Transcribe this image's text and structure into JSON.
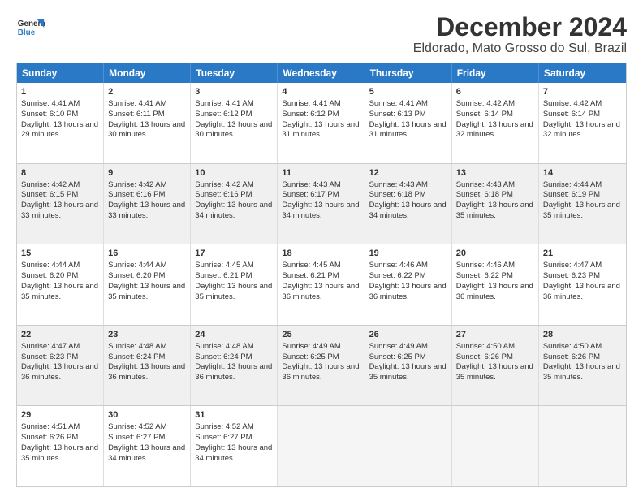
{
  "header": {
    "logo_line1": "General",
    "logo_line2": "Blue",
    "title": "December 2024",
    "subtitle": "Eldorado, Mato Grosso do Sul, Brazil"
  },
  "calendar": {
    "days": [
      "Sunday",
      "Monday",
      "Tuesday",
      "Wednesday",
      "Thursday",
      "Friday",
      "Saturday"
    ],
    "weeks": [
      [
        {
          "day": "1",
          "sunrise": "Sunrise: 4:41 AM",
          "sunset": "Sunset: 6:10 PM",
          "daylight": "Daylight: 13 hours and 29 minutes.",
          "shaded": false
        },
        {
          "day": "2",
          "sunrise": "Sunrise: 4:41 AM",
          "sunset": "Sunset: 6:11 PM",
          "daylight": "Daylight: 13 hours and 30 minutes.",
          "shaded": false
        },
        {
          "day": "3",
          "sunrise": "Sunrise: 4:41 AM",
          "sunset": "Sunset: 6:12 PM",
          "daylight": "Daylight: 13 hours and 30 minutes.",
          "shaded": false
        },
        {
          "day": "4",
          "sunrise": "Sunrise: 4:41 AM",
          "sunset": "Sunset: 6:12 PM",
          "daylight": "Daylight: 13 hours and 31 minutes.",
          "shaded": false
        },
        {
          "day": "5",
          "sunrise": "Sunrise: 4:41 AM",
          "sunset": "Sunset: 6:13 PM",
          "daylight": "Daylight: 13 hours and 31 minutes.",
          "shaded": false
        },
        {
          "day": "6",
          "sunrise": "Sunrise: 4:42 AM",
          "sunset": "Sunset: 6:14 PM",
          "daylight": "Daylight: 13 hours and 32 minutes.",
          "shaded": false
        },
        {
          "day": "7",
          "sunrise": "Sunrise: 4:42 AM",
          "sunset": "Sunset: 6:14 PM",
          "daylight": "Daylight: 13 hours and 32 minutes.",
          "shaded": false
        }
      ],
      [
        {
          "day": "8",
          "sunrise": "Sunrise: 4:42 AM",
          "sunset": "Sunset: 6:15 PM",
          "daylight": "Daylight: 13 hours and 33 minutes.",
          "shaded": true
        },
        {
          "day": "9",
          "sunrise": "Sunrise: 4:42 AM",
          "sunset": "Sunset: 6:16 PM",
          "daylight": "Daylight: 13 hours and 33 minutes.",
          "shaded": true
        },
        {
          "day": "10",
          "sunrise": "Sunrise: 4:42 AM",
          "sunset": "Sunset: 6:16 PM",
          "daylight": "Daylight: 13 hours and 34 minutes.",
          "shaded": true
        },
        {
          "day": "11",
          "sunrise": "Sunrise: 4:43 AM",
          "sunset": "Sunset: 6:17 PM",
          "daylight": "Daylight: 13 hours and 34 minutes.",
          "shaded": true
        },
        {
          "day": "12",
          "sunrise": "Sunrise: 4:43 AM",
          "sunset": "Sunset: 6:18 PM",
          "daylight": "Daylight: 13 hours and 34 minutes.",
          "shaded": true
        },
        {
          "day": "13",
          "sunrise": "Sunrise: 4:43 AM",
          "sunset": "Sunset: 6:18 PM",
          "daylight": "Daylight: 13 hours and 35 minutes.",
          "shaded": true
        },
        {
          "day": "14",
          "sunrise": "Sunrise: 4:44 AM",
          "sunset": "Sunset: 6:19 PM",
          "daylight": "Daylight: 13 hours and 35 minutes.",
          "shaded": true
        }
      ],
      [
        {
          "day": "15",
          "sunrise": "Sunrise: 4:44 AM",
          "sunset": "Sunset: 6:20 PM",
          "daylight": "Daylight: 13 hours and 35 minutes.",
          "shaded": false
        },
        {
          "day": "16",
          "sunrise": "Sunrise: 4:44 AM",
          "sunset": "Sunset: 6:20 PM",
          "daylight": "Daylight: 13 hours and 35 minutes.",
          "shaded": false
        },
        {
          "day": "17",
          "sunrise": "Sunrise: 4:45 AM",
          "sunset": "Sunset: 6:21 PM",
          "daylight": "Daylight: 13 hours and 35 minutes.",
          "shaded": false
        },
        {
          "day": "18",
          "sunrise": "Sunrise: 4:45 AM",
          "sunset": "Sunset: 6:21 PM",
          "daylight": "Daylight: 13 hours and 36 minutes.",
          "shaded": false
        },
        {
          "day": "19",
          "sunrise": "Sunrise: 4:46 AM",
          "sunset": "Sunset: 6:22 PM",
          "daylight": "Daylight: 13 hours and 36 minutes.",
          "shaded": false
        },
        {
          "day": "20",
          "sunrise": "Sunrise: 4:46 AM",
          "sunset": "Sunset: 6:22 PM",
          "daylight": "Daylight: 13 hours and 36 minutes.",
          "shaded": false
        },
        {
          "day": "21",
          "sunrise": "Sunrise: 4:47 AM",
          "sunset": "Sunset: 6:23 PM",
          "daylight": "Daylight: 13 hours and 36 minutes.",
          "shaded": false
        }
      ],
      [
        {
          "day": "22",
          "sunrise": "Sunrise: 4:47 AM",
          "sunset": "Sunset: 6:23 PM",
          "daylight": "Daylight: 13 hours and 36 minutes.",
          "shaded": true
        },
        {
          "day": "23",
          "sunrise": "Sunrise: 4:48 AM",
          "sunset": "Sunset: 6:24 PM",
          "daylight": "Daylight: 13 hours and 36 minutes.",
          "shaded": true
        },
        {
          "day": "24",
          "sunrise": "Sunrise: 4:48 AM",
          "sunset": "Sunset: 6:24 PM",
          "daylight": "Daylight: 13 hours and 36 minutes.",
          "shaded": true
        },
        {
          "day": "25",
          "sunrise": "Sunrise: 4:49 AM",
          "sunset": "Sunset: 6:25 PM",
          "daylight": "Daylight: 13 hours and 36 minutes.",
          "shaded": true
        },
        {
          "day": "26",
          "sunrise": "Sunrise: 4:49 AM",
          "sunset": "Sunset: 6:25 PM",
          "daylight": "Daylight: 13 hours and 35 minutes.",
          "shaded": true
        },
        {
          "day": "27",
          "sunrise": "Sunrise: 4:50 AM",
          "sunset": "Sunset: 6:26 PM",
          "daylight": "Daylight: 13 hours and 35 minutes.",
          "shaded": true
        },
        {
          "day": "28",
          "sunrise": "Sunrise: 4:50 AM",
          "sunset": "Sunset: 6:26 PM",
          "daylight": "Daylight: 13 hours and 35 minutes.",
          "shaded": true
        }
      ],
      [
        {
          "day": "29",
          "sunrise": "Sunrise: 4:51 AM",
          "sunset": "Sunset: 6:26 PM",
          "daylight": "Daylight: 13 hours and 35 minutes.",
          "shaded": false
        },
        {
          "day": "30",
          "sunrise": "Sunrise: 4:52 AM",
          "sunset": "Sunset: 6:27 PM",
          "daylight": "Daylight: 13 hours and 34 minutes.",
          "shaded": false
        },
        {
          "day": "31",
          "sunrise": "Sunrise: 4:52 AM",
          "sunset": "Sunset: 6:27 PM",
          "daylight": "Daylight: 13 hours and 34 minutes.",
          "shaded": false
        },
        {
          "day": "",
          "sunrise": "",
          "sunset": "",
          "daylight": "",
          "shaded": false,
          "empty": true
        },
        {
          "day": "",
          "sunrise": "",
          "sunset": "",
          "daylight": "",
          "shaded": false,
          "empty": true
        },
        {
          "day": "",
          "sunrise": "",
          "sunset": "",
          "daylight": "",
          "shaded": false,
          "empty": true
        },
        {
          "day": "",
          "sunrise": "",
          "sunset": "",
          "daylight": "",
          "shaded": false,
          "empty": true
        }
      ]
    ]
  }
}
